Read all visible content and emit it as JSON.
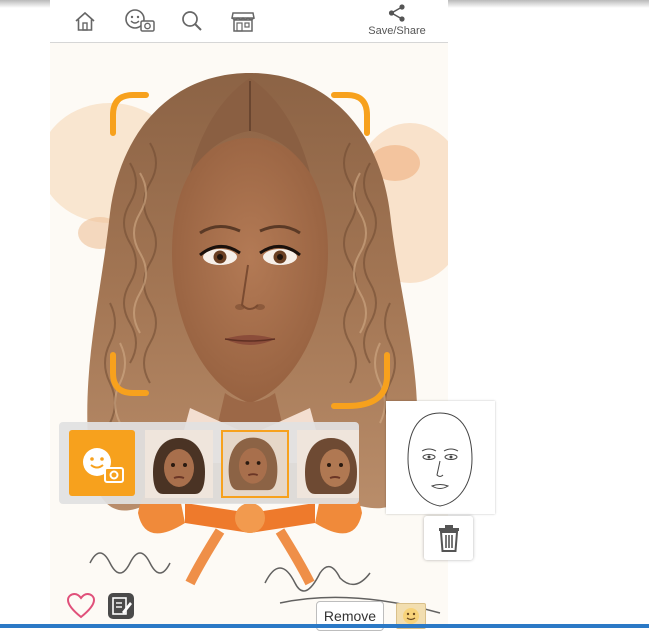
{
  "toolbar": {
    "share_label": "Save/Share",
    "icons": [
      "home-icon",
      "face-camera-icon",
      "search-icon",
      "store-icon",
      "share-icon"
    ]
  },
  "canvas": {
    "signature_text": "Moment"
  },
  "face_strip": {
    "items": [
      {
        "name": "face-camera-button"
      },
      {
        "name": "face-thumbnail-1",
        "selected": false
      },
      {
        "name": "face-thumbnail-2",
        "selected": true
      },
      {
        "name": "face-thumbnail-3",
        "selected": false
      }
    ]
  },
  "actions": {
    "remove_label": "Remove"
  },
  "colors": {
    "accent": "#f7a11d",
    "hair": "#a37654",
    "skin": "#a86f4c",
    "bow": "#f08a3a",
    "taskbar": "#2b79c6"
  }
}
